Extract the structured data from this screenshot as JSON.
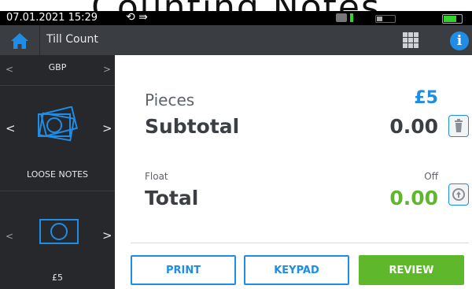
{
  "caption": "Counting Notes",
  "status_bar": {
    "datetime": "07.01.2021 15:29",
    "sync_symbol": "⟲ ⇛"
  },
  "header": {
    "title": "Till Count"
  },
  "sidebar": {
    "currency": "GBP",
    "tiles": [
      {
        "label": "LOOSE NOTES",
        "icon": "note-stack-icon"
      },
      {
        "label": "£5",
        "icon": "banknote-icon"
      }
    ]
  },
  "main": {
    "pieces_label": "Pieces",
    "pieces_value": "£5",
    "subtotal_label": "Subtotal",
    "subtotal_value": "0.00",
    "float_label": "Float",
    "float_value": "Off",
    "total_label": "Total",
    "total_value": "0.00"
  },
  "buttons": {
    "print": "PRINT",
    "keypad": "KEYPAD",
    "review": "REVIEW"
  },
  "colors": {
    "accent": "#1f8ce6",
    "success": "#5fb82c",
    "sidebar_bg": "#26282b",
    "header_bg": "#3a3d42"
  }
}
